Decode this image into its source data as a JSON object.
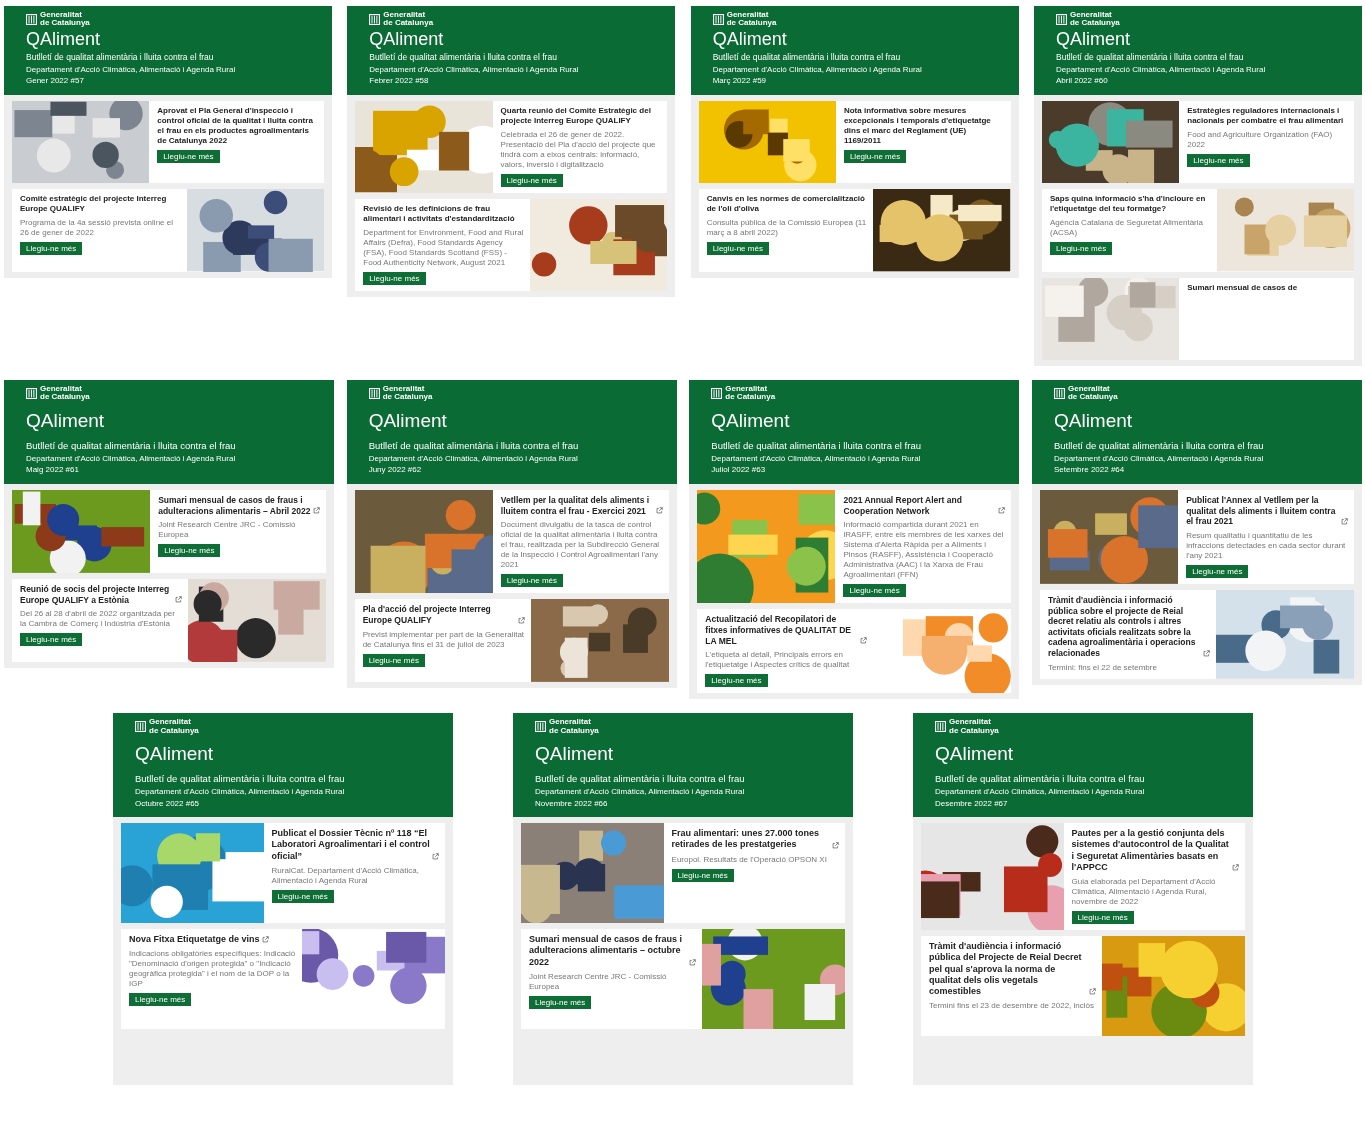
{
  "newsletter_rows": [
    [
      {
        "brand": [
          "Generalitat",
          "de Catalunya"
        ],
        "title": "QAliment",
        "subtitle": "Butlletí de qualitat alimentària i lluita contra el frau",
        "department": "Departament d'Acció Climàtica, Alimentació i Agenda Rural",
        "issue": "Gener 2022 #57",
        "articles": [
          {
            "kind": "image-left",
            "title": "Aprovat el Pla General d'inspecció i control oficial de la qualitat i lluita contra el frau en els productes agroalimentaris de Catalunya 2022",
            "external_link": false,
            "button": "Llegiu-ne més"
          },
          {
            "kind": "image-right",
            "title": "Comitè estratègic del projecte Interreg Europe QUALIFY",
            "external_link": false,
            "source": "Programa de la 4a sessió prevista online el 26 de gener de 2022",
            "button": "Llegiu-ne més"
          }
        ]
      },
      {
        "brand": [
          "Generalitat",
          "de Catalunya"
        ],
        "title": "QAliment",
        "subtitle": "Butlletí de qualitat alimentària i lluita contra el frau",
        "department": "Departament d'Acció Climàtica, Alimentació i Agenda Rural",
        "issue": "Febrer 2022 #58",
        "articles": [
          {
            "kind": "image-left",
            "title": "Quarta reunió del Comitè Estratègic del projecte Interreg Europe QUALIFY",
            "external_link": false,
            "source": "Celebrada el 26 de gener de 2022. Presentació del Pla d'acció del projecte que tindrà com a eixos centrals: informació, valors, inversió i digitalització",
            "button": "Llegiu-ne més"
          },
          {
            "kind": "image-right",
            "title": "Revisió de les definicions de frau alimentari i activitats d'estandardització",
            "external_link": false,
            "source": "Department for Environment, Food and Rural Affairs (Defra), Food Standards Agency (FSA), Food Standards Scotland (FSS) - Food Authenticity Network, August 2021",
            "button": "Llegiu-ne més"
          }
        ]
      },
      {
        "brand": [
          "Generalitat",
          "de Catalunya"
        ],
        "title": "QAliment",
        "subtitle": "Butlletí de qualitat alimentària i lluita contra el frau",
        "department": "Departament d'Acció Climàtica, Alimentació i Agenda Rural",
        "issue": "Març 2022 #59",
        "articles": [
          {
            "kind": "image-left",
            "title": "Nota informativa sobre mesures excepcionals i temporals d'etiquetatge dins el marc del Reglament (UE) 1169/2011",
            "external_link": false,
            "button": "Llegiu-ne més"
          },
          {
            "kind": "image-right",
            "title": "Canvis en les normes de comercialització de l'oli d'oliva",
            "external_link": false,
            "source": "Consulta pública de la Comissió Europea (11 març a 8 abril 2022)",
            "button": "Llegiu-ne més"
          }
        ]
      },
      {
        "brand": [
          "Generalitat",
          "de Catalunya"
        ],
        "title": "QAliment",
        "subtitle": "Butlletí de qualitat alimentària i lluita contra el frau",
        "department": "Departament d'Acció Climàtica, Alimentació i Agenda Rural",
        "issue": "Abril 2022 #60",
        "articles": [
          {
            "kind": "image-left",
            "title": "Estratègies reguladores internacionals i nacionals per combatre el frau alimentari",
            "external_link": false,
            "source": "Food and Agriculture Organization (FAO) 2022",
            "button": "Llegiu-ne més"
          },
          {
            "kind": "image-right",
            "title": "Saps quina informació s'ha d'incloure en l'etiquetatge del teu formatge?",
            "external_link": false,
            "source": "Agència Catalana de Seguretat Alimentària (ACSA)",
            "button": "Llegiu-ne més"
          },
          {
            "kind": "image-left",
            "title": "Sumari mensual de casos de",
            "external_link": false
          }
        ]
      }
    ],
    [
      {
        "brand": [
          "Generalitat",
          "de Catalunya"
        ],
        "title": "QAliment",
        "subtitle": "Butlletí de qualitat alimentària i lluita contra el frau",
        "department": "Departament d'Acció Climàtica, Alimentació i Agenda Rural",
        "issue": "Maig 2022 #61",
        "articles": [
          {
            "kind": "image-left",
            "title": "Sumari mensual de casos de fraus i adulteracions alimentaris – Abril 2022",
            "external_link": true,
            "source": "Joint Research Centre JRC - Comissió Europea",
            "button": "Llegiu-ne més"
          },
          {
            "kind": "image-right",
            "title": "Reunió de socis del projecte Interreg Europe QUALIFY a Estònia",
            "external_link": true,
            "source": "Del 26 al 28 d'abril de 2022 organitzada per la Cambra de Comerç i Indústria d'Estònia",
            "button": "Llegiu-ne més"
          }
        ]
      },
      {
        "brand": [
          "Generalitat",
          "de Catalunya"
        ],
        "title": "QAliment",
        "subtitle": "Butlletí de qualitat alimentària i lluita contra el frau",
        "department": "Departament d'Acció Climàtica, Alimentació i Agenda Rural",
        "issue": "Juny 2022 #62",
        "articles": [
          {
            "kind": "image-left",
            "title": "Vetllem per la qualitat dels aliments i lluitem contra el frau - Exercici 2021",
            "external_link": true,
            "source": "Document divulgatiu de la tasca de control oficial de la qualitat alimentària i lluita contra el frau, realitzada per la Subdirecció General de la Inspecció i Control Agroalimentari l'any 2021",
            "button": "Llegiu-ne més"
          },
          {
            "kind": "image-right",
            "title": "Pla d'acció del projecte Interreg Europe QUALIFY",
            "external_link": true,
            "source": "Previst implementar per part de la Generalitat de Catalunya fins el 31 de juliol de 2023",
            "button": "Llegiu-ne més"
          }
        ]
      },
      {
        "brand": [
          "Generalitat",
          "de Catalunya"
        ],
        "title": "QAliment",
        "subtitle": "Butlletí de qualitat alimentària i lluita contra el frau",
        "department": "Departament d'Acció Climàtica, Alimentació i Agenda Rural",
        "issue": "Juliol 2022 #63",
        "articles": [
          {
            "kind": "image-left",
            "title": "2021 Annual Report Alert and Cooperation Network",
            "external_link": true,
            "source": "Informació compartida durant 2021 en iRASFF, entre els membres de les xarxes del Sistema d'Alerta Ràpida per a Aliments i Pinsos (RASFF), Assistència i Cooperació Administrativa (AAC) i la Xarxa de Frau Agroalimentari (FFN)",
            "button": "Llegiu-ne més"
          },
          {
            "kind": "image-right",
            "title": "Actualització del Recopilatori de fitxes informatives de QUALITAT DE LA MEL",
            "external_link": true,
            "source": "L'etiqueta al detall, Principals errors en l'etiquetatge i Aspectes crítics de qualitat",
            "button": "Llegiu-ne més"
          }
        ]
      },
      {
        "brand": [
          "Generalitat",
          "de Catalunya"
        ],
        "title": "QAliment",
        "subtitle": "Butlletí de qualitat alimentària i lluita contra el frau",
        "department": "Departament d'Acció Climàtica, Alimentació i Agenda Rural",
        "issue": "Setembre 2022 #64",
        "articles": [
          {
            "kind": "image-left",
            "title": "Publicat l'Annex al Vetllem per la qualitat dels aliments i lluitem contra el frau 2021",
            "external_link": true,
            "source": "Resum qualitatiu i quantitatiu de les infraccions detectades en cada sector durant l'any 2021",
            "button": "Llegiu-ne més"
          },
          {
            "kind": "image-right",
            "title": "Tràmit d'audiència i informació pública sobre el projecte de Reial decret relatiu als controls i altres activitats oficials realitzats sobre la cadena agroalimentària i operacions relacionades",
            "external_link": true,
            "source": "Termini: fins el 22 de setembre"
          }
        ]
      }
    ],
    [
      {
        "brand": [
          "Generalitat",
          "de Catalunya"
        ],
        "title": "QAliment",
        "subtitle": "Butlletí de qualitat alimentària i lluita contra el frau",
        "department": "Departament d'Acció Climàtica, Alimentació i Agenda Rural",
        "issue": "Octubre 2022 #65",
        "articles": [
          {
            "kind": "image-left",
            "title": "Publicat el Dossier Tècnic nº 118 “El Laboratori Agroalimentari i el control oficial”",
            "external_link": true,
            "source": "RuralCat. Departament d'Acció Climàtica, Alimentació i Agenda Rural",
            "button": "Llegiu-ne més"
          },
          {
            "kind": "image-right",
            "title": "Nova Fitxa Etiquetatge de vins",
            "external_link": true,
            "source": "Indicacions obligatòries específiques: Indicació \"Denominació d'origen protegida\" o \"Indicació geogràfica protegida\" i el nom de la DOP o la IGP",
            "button": "Llegiu-ne més"
          }
        ]
      },
      {
        "brand": [
          "Generalitat",
          "de Catalunya"
        ],
        "title": "QAliment",
        "subtitle": "Butlletí de qualitat alimentària i lluita contra el frau",
        "department": "Departament d'Acció Climàtica, Alimentació i Agenda Rural",
        "issue": "Novembre 2022 #66",
        "articles": [
          {
            "kind": "image-left",
            "title": "Frau alimentari: unes 27.000 tones retirades de les prestatgeries",
            "external_link": true,
            "source": "Europol. Resultats de l'Operació OPSON XI",
            "button": "Llegiu-ne més"
          },
          {
            "kind": "image-right",
            "title": "Sumari mensual de casos de fraus i adulteracions alimentaris – octubre 2022",
            "external_link": true,
            "source": "Joint Research Centre JRC - Comissió Europea",
            "button": "Llegiu-ne més"
          }
        ]
      },
      {
        "brand": [
          "Generalitat",
          "de Catalunya"
        ],
        "title": "QAliment",
        "subtitle": "Butlletí de qualitat alimentària i lluita contra el frau",
        "department": "Departament d'Acció Climàtica, Alimentació i Agenda Rural",
        "issue": "Desembre 2022 #67",
        "articles": [
          {
            "kind": "image-left",
            "title": "Pautes per a la gestió conjunta dels sistemes d'autocontrol de la Qualitat i Seguretat Alimentàries basats en l'APPCC",
            "external_link": true,
            "source": "Guia elaborada pel Departament d'Acció Climàtica, Alimentació i Agenda Rural, novembre de 2022",
            "button": "Llegiu-ne més"
          },
          {
            "kind": "image-right",
            "title": "Tràmit d'audiència i informació pública del Projecte de Reial Decret pel qual s'aprova la norma de qualitat dels olis vegetals comestibles",
            "external_link": true,
            "source": "Termini fins el 23 de desembre de 2022, inclòs"
          }
        ]
      }
    ]
  ]
}
